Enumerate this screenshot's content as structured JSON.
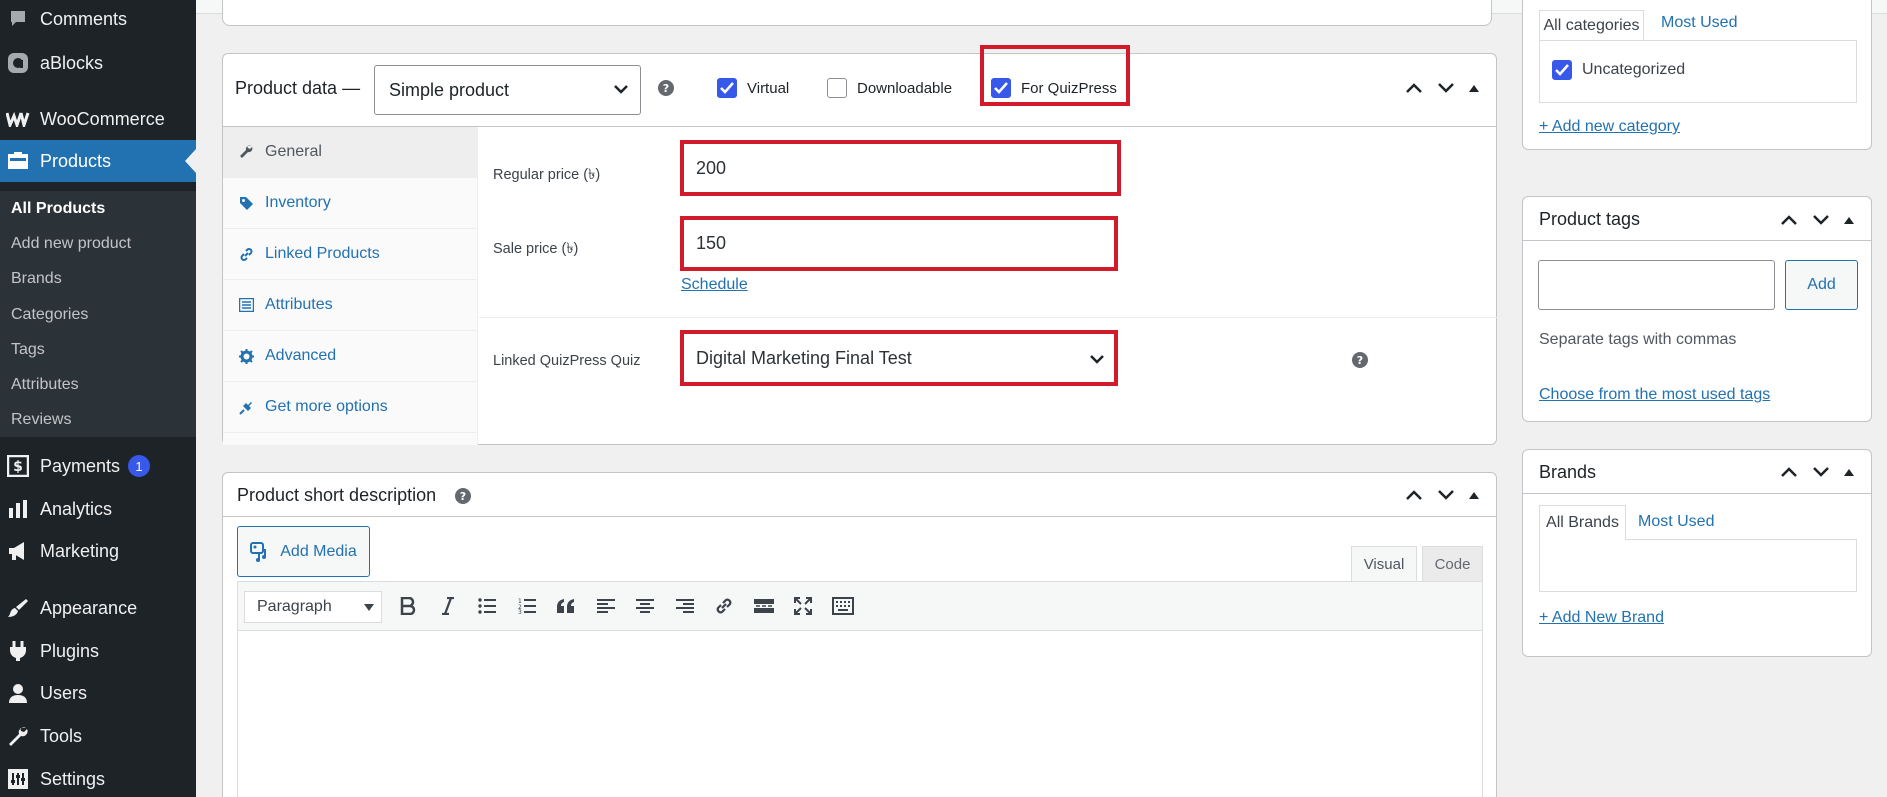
{
  "sidebar": {
    "menu": [
      {
        "label": "Comments",
        "icon": "comment-icon"
      },
      {
        "label": "aBlocks",
        "icon": "ablocks-icon"
      },
      {
        "label": "WooCommerce",
        "icon": "woocommerce-icon"
      },
      {
        "label": "Products",
        "icon": "products-icon"
      },
      {
        "label": "Payments",
        "icon": "payments-icon",
        "badge": "1"
      },
      {
        "label": "Analytics",
        "icon": "analytics-icon"
      },
      {
        "label": "Marketing",
        "icon": "marketing-icon"
      },
      {
        "label": "Appearance",
        "icon": "appearance-icon"
      },
      {
        "label": "Plugins",
        "icon": "plugins-icon"
      },
      {
        "label": "Users",
        "icon": "users-icon"
      },
      {
        "label": "Tools",
        "icon": "tools-icon"
      },
      {
        "label": "Settings",
        "icon": "settings-icon"
      }
    ],
    "submenu": [
      "All Products",
      "Add new product",
      "Brands",
      "Categories",
      "Tags",
      "Attributes",
      "Reviews"
    ]
  },
  "product_data": {
    "title": "Product data —",
    "type_value": "Simple product",
    "checkboxes": [
      {
        "label": "Virtual",
        "checked": true
      },
      {
        "label": "Downloadable",
        "checked": false
      },
      {
        "label": "For QuizPress",
        "checked": true
      }
    ],
    "tabs": [
      "General",
      "Inventory",
      "Linked Products",
      "Attributes",
      "Advanced",
      "Get more options"
    ],
    "regular_price_label": "Regular price (৳)",
    "regular_price_value": "200",
    "sale_price_label": "Sale price (৳)",
    "sale_price_value": "150",
    "schedule_link": "Schedule",
    "quiz_label": "Linked QuizPress Quiz",
    "quiz_value": "Digital Marketing Final Test"
  },
  "short_description": {
    "title": "Product short description",
    "add_media": "Add Media",
    "tab_visual": "Visual",
    "tab_code": "Code",
    "format_value": "Paragraph",
    "toolbar": [
      "bold-icon",
      "italic-icon",
      "bullet-list-icon",
      "numbered-list-icon",
      "blockquote-icon",
      "align-left-icon",
      "align-center-icon",
      "align-right-icon",
      "link-icon",
      "read-more-icon",
      "fullscreen-icon",
      "toolbar-toggle-icon"
    ]
  },
  "categories": {
    "tab_all": "All categories",
    "tab_most_used": "Most Used",
    "items": [
      {
        "label": "Uncategorized",
        "checked": true
      }
    ],
    "add_link": "+ Add new category"
  },
  "tags": {
    "title": "Product tags",
    "input_value": "",
    "add_button": "Add",
    "hint": "Separate tags with commas",
    "choose_link": "Choose from the most used tags"
  },
  "brands": {
    "title": "Brands",
    "tab_all": "All Brands",
    "tab_most_used": "Most Used",
    "add_link": "+ Add New Brand"
  },
  "colors": {
    "sidebar_bg": "#1d2327",
    "active_menu": "#2271b1",
    "link": "#2271b1",
    "checkbox": "#3858e9",
    "highlight": "#d11a2a"
  }
}
